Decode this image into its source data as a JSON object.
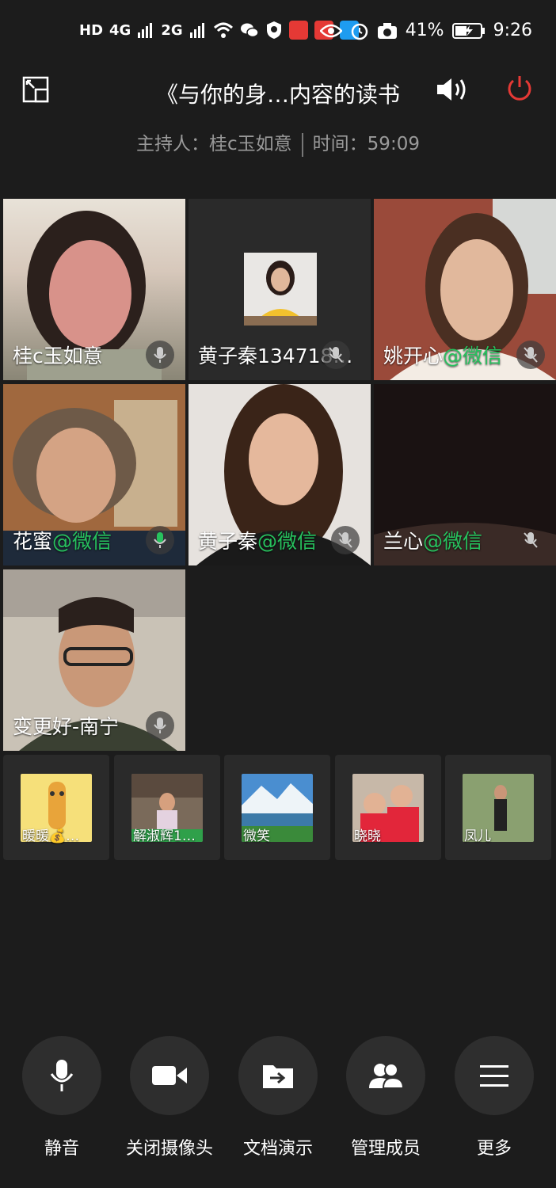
{
  "status_bar": {
    "network": "HD",
    "signal1": "4G",
    "signal2": "2G",
    "battery": "41%",
    "time": "9:26"
  },
  "meeting": {
    "title": "《与你的身…内容的读书",
    "host_label": "主持人：桂c玉如意",
    "time_label": "时间：59:09"
  },
  "participants": [
    {
      "name": "桂c玉如意",
      "suffix": "",
      "mic": "on"
    },
    {
      "name": "黄子秦134718…",
      "suffix": "",
      "mic": "muted"
    },
    {
      "name": "姚开心",
      "suffix": "@微信",
      "mic": "muted"
    },
    {
      "name": "花蜜",
      "suffix": "@微信",
      "mic": "active"
    },
    {
      "name": "黄子秦",
      "suffix": "@微信",
      "mic": "muted"
    },
    {
      "name": "兰心",
      "suffix": "@微信",
      "mic": "muted"
    },
    {
      "name": "变更好-南宁",
      "suffix": "",
      "mic": "on"
    }
  ],
  "thumbnails": [
    {
      "name": "暖暖💰…"
    },
    {
      "name": "解淑辉1…"
    },
    {
      "name": "微笑"
    },
    {
      "name": "晓晓"
    },
    {
      "name": "凤儿"
    }
  ],
  "controls": [
    {
      "label": "静音",
      "icon": "microphone-icon"
    },
    {
      "label": "关闭摄像头",
      "icon": "video-camera-icon"
    },
    {
      "label": "文档演示",
      "icon": "share-document-icon"
    },
    {
      "label": "管理成员",
      "icon": "members-icon"
    },
    {
      "label": "更多",
      "icon": "menu-icon"
    }
  ],
  "colors": {
    "background": "#1c1c1c",
    "wechat_green": "#27c25e",
    "power_red": "#e53935"
  }
}
